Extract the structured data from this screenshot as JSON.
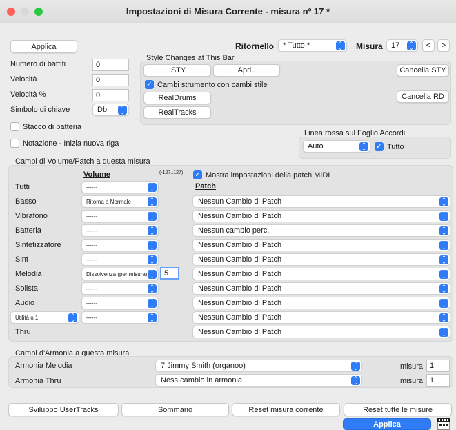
{
  "window": {
    "title": "Impostazioni di Misura Corrente - misura nº  17 *"
  },
  "top": {
    "apply_label": "Applica",
    "ritornello_label": "Ritornello",
    "ritornello_value": "* Tutto *",
    "misura_label": "Misura",
    "misura_value": "17",
    "prev_label": "<",
    "next_label": ">"
  },
  "left_fields": {
    "beats_label": "Numero di battiti",
    "beats_value": "0",
    "velocity_label": "Velocità",
    "velocity_value": "0",
    "velocity_pct_label": "Velocità %",
    "velocity_pct_value": "0",
    "key_label": "Simbolo di chiave",
    "key_value": "Db",
    "drum_stop_label": "Stacco di batteria",
    "new_line_label": "Notazione - Inizia nuova riga"
  },
  "style": {
    "title": "Style Changes at This Bar",
    "sty_btn": ".STY",
    "open_btn": "Apri..",
    "cancel_sty_btn": "Cancella STY",
    "instrument_change_label": "Cambi strumento con cambi stile",
    "realdrums_btn": "RealDrums",
    "cancel_rd_btn": "Cancella RD",
    "realtracks_btn": "RealTracks"
  },
  "redline": {
    "label": "Linea rossa sul Foglio Accordi",
    "value": "Auto",
    "all_label": "Tutto"
  },
  "volpatch": {
    "title": "Cambi di Volume/Patch a questa misura",
    "volume_header": "Volume",
    "range": "(-127..127)",
    "midi_label": "Mostra impostazioni della patch MIDI",
    "patch_header": "Patch",
    "rows": [
      {
        "name": "Tutti",
        "volume": "------",
        "patch": ""
      },
      {
        "name": "Basso",
        "volume": "Ritorna a Normale",
        "patch": "Nessun Cambio di Patch"
      },
      {
        "name": "Vibrafono",
        "volume": "------",
        "patch": "Nessun Cambio di Patch"
      },
      {
        "name": "Batteria",
        "volume": "------",
        "patch": "Nessun cambio perc."
      },
      {
        "name": "Sintetizzatore",
        "volume": "------",
        "patch": "Nessun Cambio di Patch"
      },
      {
        "name": "Sint",
        "volume": "------",
        "patch": "Nessun Cambio di Patch"
      },
      {
        "name": "Melodia",
        "volume": "Dissolvenza (per misura)",
        "patch": "Nessun Cambio di Patch",
        "extra": "5"
      },
      {
        "name": "Solista",
        "volume": "------",
        "patch": "Nessun Cambio di Patch"
      },
      {
        "name": "Audio",
        "volume": "------",
        "patch": "Nessun Cambio di Patch"
      },
      {
        "name": "Utilità n.1",
        "volume": "------",
        "patch": "Nessun Cambio di Patch"
      },
      {
        "name": "Thru",
        "volume": "",
        "patch": "Nessun Cambio di Patch"
      }
    ]
  },
  "harmony": {
    "title": "Cambi d'Armonia a questa misura",
    "melody_label": "Armonia Melodia",
    "melody_value": "7 Jimmy Smith (organoo)",
    "melody_misura_label": "misura",
    "melody_misura_value": "1",
    "thru_label": "Armonia Thru",
    "thru_value": "Ness.cambio in armonia",
    "thru_misura_label": "misura",
    "thru_misura_value": "1"
  },
  "bottom": {
    "usertracks_btn": "Sviluppo UserTracks",
    "summary_btn": "Sommario",
    "reset_bar_btn": "Reset misura corrente",
    "reset_all_btn": "Reset tutte le misure",
    "apply_btn": "Applica"
  },
  "colors": {
    "accent": "#2f7cf6"
  }
}
